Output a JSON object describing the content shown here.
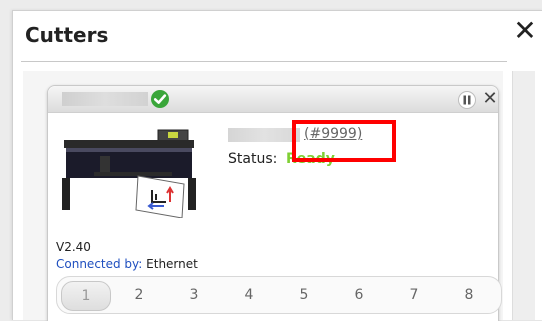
{
  "window": {
    "title": "Cutters",
    "close_label": "✕"
  },
  "card": {
    "status_icon": "check-circle-icon",
    "pause_icon": "pause-icon",
    "close_label": "✕",
    "device_id": "(#9999)",
    "status_label": "Status:",
    "status_value": "Ready",
    "version": "V2.40",
    "connected_label": "Connected by:",
    "connected_value": "Ethernet",
    "pages": [
      "1",
      "2",
      "3",
      "4",
      "5",
      "6",
      "7",
      "8"
    ],
    "active_page": "1"
  },
  "colors": {
    "status_ready": "#7fcf33",
    "ok_icon": "#3aa63a",
    "highlight": "#ff0000",
    "link": "#1f4fbf"
  }
}
